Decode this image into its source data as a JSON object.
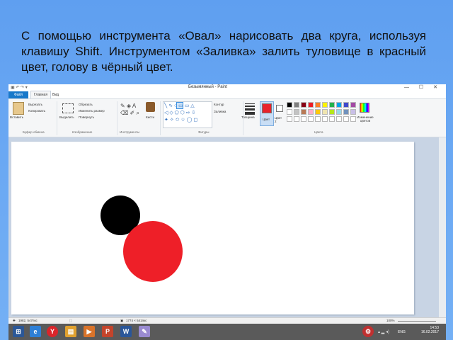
{
  "instruction": "С помощью инструмента «Овал» нарисовать два круга, используя клавишу Shift. Инструментом «Заливка» залить туловище в красный цвет, голову в чёрный цвет.",
  "window": {
    "title": "Безымянный - Paint"
  },
  "tabs": {
    "file": "Файл",
    "home": "Главная",
    "view": "Вид"
  },
  "ribbon": {
    "clipboard": {
      "paste": "Вставить",
      "cut": "Вырезать",
      "copy": "Копировать",
      "label": "Буфер обмена"
    },
    "image": {
      "select": "Выделить",
      "crop": "Обрезать",
      "resize": "Изменить размер",
      "rotate": "Повернуть",
      "label": "Изображение"
    },
    "tools": {
      "brushes": "Кисти",
      "label": "Инструменты"
    },
    "shapes": {
      "outline": "Контур",
      "fill": "Заливка",
      "label": "Фигуры"
    },
    "size_label": "Толщина",
    "colors": {
      "color1": "Цвет",
      "color2": "Цвет 2",
      "edit": "Изменение цветов",
      "label": "Цвета",
      "color1_value": "#e8232c",
      "color2_value": "#ffffff"
    },
    "palette": [
      "#000000",
      "#7f7f7f",
      "#880015",
      "#ed1c24",
      "#ff7f27",
      "#fff200",
      "#22b14c",
      "#00a2e8",
      "#3f48cc",
      "#a349a4",
      "#ffffff",
      "#c3c3c3",
      "#b97a57",
      "#ffaec9",
      "#ffc90e",
      "#efe4b0",
      "#b5e61d",
      "#99d9ea",
      "#7092be",
      "#c8bfe7"
    ]
  },
  "drawing": {
    "head_color": "#000000",
    "body_color": "#ee1f28"
  },
  "status": {
    "cursor_pos": "1982, 547пкс",
    "selection": "",
    "canvas_size": "1774 × 541пкс",
    "zoom": "100%"
  },
  "tray": {
    "lang": "ENG",
    "time": "14:53",
    "date": "16.02.2017"
  }
}
